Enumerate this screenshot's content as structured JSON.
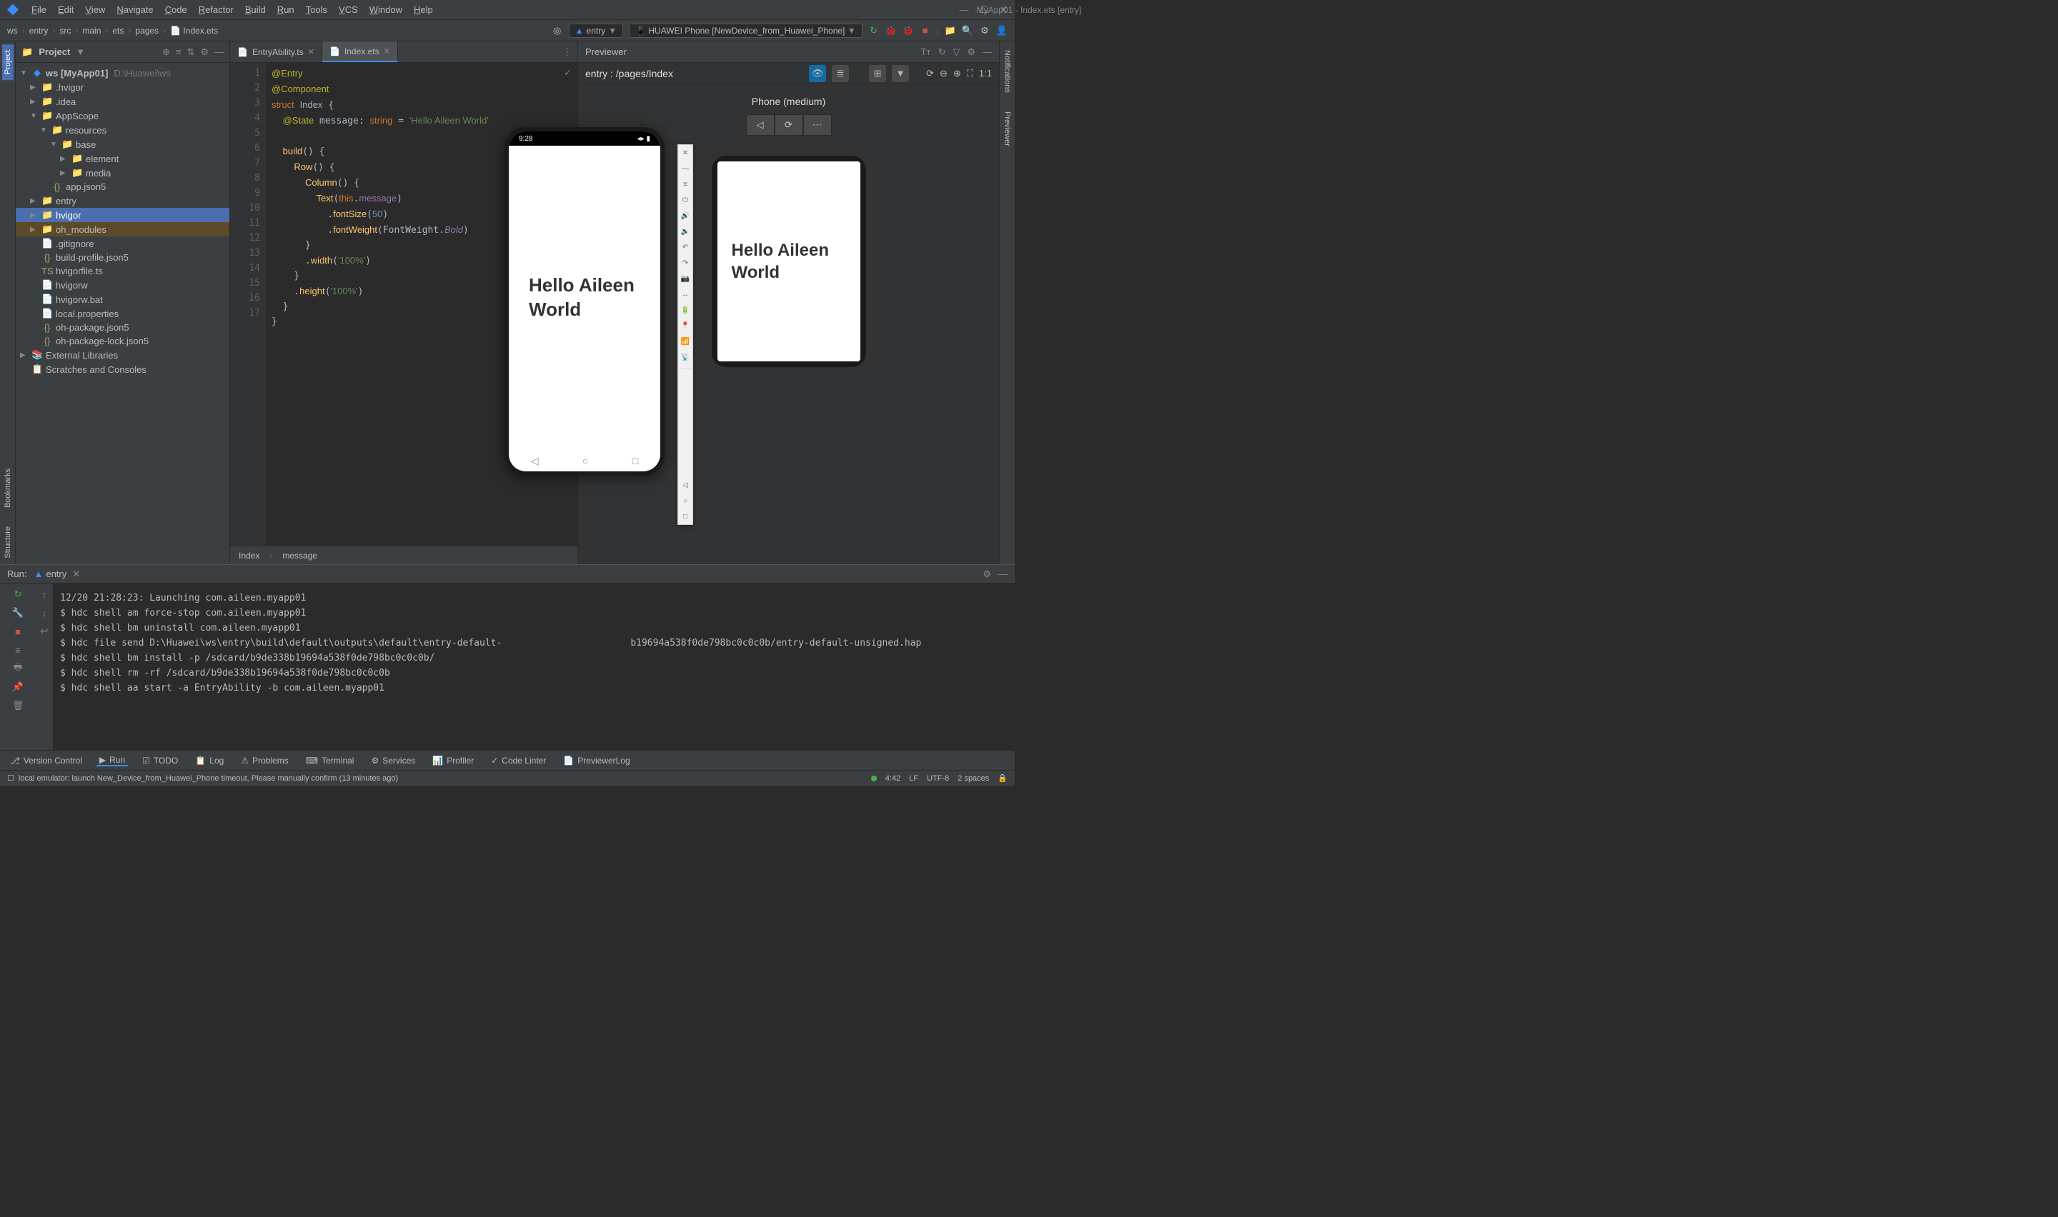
{
  "window_title": "MyApp01 - Index.ets [entry]",
  "menus": [
    "File",
    "Edit",
    "View",
    "Navigate",
    "Code",
    "Refactor",
    "Build",
    "Run",
    "Tools",
    "VCS",
    "Window",
    "Help"
  ],
  "breadcrumb": [
    "ws",
    "entry",
    "src",
    "main",
    "ets",
    "pages",
    "Index.ets"
  ],
  "run_config": "entry",
  "device": "HUAWEI Phone [NewDevice_from_Huawei_Phone]",
  "project": {
    "title": "Project",
    "root": {
      "name": "ws",
      "bold": "[MyApp01]",
      "path": "D:\\Huawei\\ws"
    },
    "tree": [
      {
        "indent": 1,
        "arrow": "▶",
        "icon": "folder",
        "name": ".hvigor"
      },
      {
        "indent": 1,
        "arrow": "▶",
        "icon": "folder",
        "name": ".idea"
      },
      {
        "indent": 1,
        "arrow": "▼",
        "icon": "folder",
        "name": "AppScope"
      },
      {
        "indent": 2,
        "arrow": "▼",
        "icon": "folder",
        "name": "resources"
      },
      {
        "indent": 3,
        "arrow": "▼",
        "icon": "folder",
        "name": "base"
      },
      {
        "indent": 4,
        "arrow": "▶",
        "icon": "folder",
        "name": "element"
      },
      {
        "indent": 4,
        "arrow": "▶",
        "icon": "folder",
        "name": "media"
      },
      {
        "indent": 2,
        "arrow": "",
        "icon": "json",
        "name": "app.json5"
      },
      {
        "indent": 1,
        "arrow": "▶",
        "icon": "module",
        "name": "entry",
        "class": "module"
      },
      {
        "indent": 1,
        "arrow": "▶",
        "icon": "folder",
        "name": "hvigor",
        "selected": true
      },
      {
        "indent": 1,
        "arrow": "▶",
        "icon": "folder-ex",
        "name": "oh_modules",
        "highlighted": true
      },
      {
        "indent": 1,
        "arrow": "",
        "icon": "file",
        "name": ".gitignore"
      },
      {
        "indent": 1,
        "arrow": "",
        "icon": "json",
        "name": "build-profile.json5"
      },
      {
        "indent": 1,
        "arrow": "",
        "icon": "ts",
        "name": "hvigorfile.ts"
      },
      {
        "indent": 1,
        "arrow": "",
        "icon": "file",
        "name": "hvigorw"
      },
      {
        "indent": 1,
        "arrow": "",
        "icon": "file",
        "name": "hvigorw.bat"
      },
      {
        "indent": 1,
        "arrow": "",
        "icon": "file",
        "name": "local.properties"
      },
      {
        "indent": 1,
        "arrow": "",
        "icon": "json",
        "name": "oh-package.json5"
      },
      {
        "indent": 1,
        "arrow": "",
        "icon": "json",
        "name": "oh-package-lock.json5"
      },
      {
        "indent": 0,
        "arrow": "▶",
        "icon": "lib",
        "name": "External Libraries"
      },
      {
        "indent": 0,
        "arrow": "",
        "icon": "scratch",
        "name": "Scratches and Consoles"
      }
    ]
  },
  "editor": {
    "tabs": [
      {
        "name": "EntryAbility.ts",
        "active": false
      },
      {
        "name": "Index.ets",
        "active": true
      }
    ],
    "line_count": 17,
    "breadcrumb": [
      "Index",
      "message"
    ]
  },
  "previewer": {
    "title": "Previewer",
    "entry": "entry : /pages/Index",
    "device_label": "Phone (medium)",
    "text": "Hello Aileen World"
  },
  "emulator": {
    "time": "9:28",
    "text": "Hello Aileen World"
  },
  "run": {
    "header": "Run:",
    "tab": "entry",
    "lines": [
      "12/20 21:28:23: Launching com.aileen.myapp01",
      "$ hdc shell am force-stop com.aileen.myapp01",
      "$ hdc shell bm uninstall com.aileen.myapp01",
      "$ hdc file send D:\\Huawei\\ws\\entry\\build\\default\\outputs\\default\\entry-default-                       b19694a538f0de798bc0c0c0b/entry-default-unsigned.hap",
      "$ hdc shell bm install -p /sdcard/b9de338b19694a538f0de798bc0c0c0b/",
      "$ hdc shell rm -rf /sdcard/b9de338b19694a538f0de798bc0c0c0b",
      "$ hdc shell aa start -a EntryAbility -b com.aileen.myapp01"
    ]
  },
  "bottom_tabs": [
    "Version Control",
    "Run",
    "TODO",
    "Log",
    "Problems",
    "Terminal",
    "Services",
    "Profiler",
    "Code Linter",
    "PreviewerLog"
  ],
  "status": {
    "message": "local emulator: launch New_Device_from_Huawei_Phone timeout, Please manually confirm (13 minutes ago)",
    "time": "4:42",
    "lf": "LF",
    "encoding": "UTF-8",
    "spaces": "2 spaces"
  },
  "left_tabs": [
    "Project"
  ],
  "left_tabs_bottom": [
    "Bookmarks",
    "Structure"
  ],
  "right_tabs": [
    "Notifications",
    "Previewer"
  ]
}
